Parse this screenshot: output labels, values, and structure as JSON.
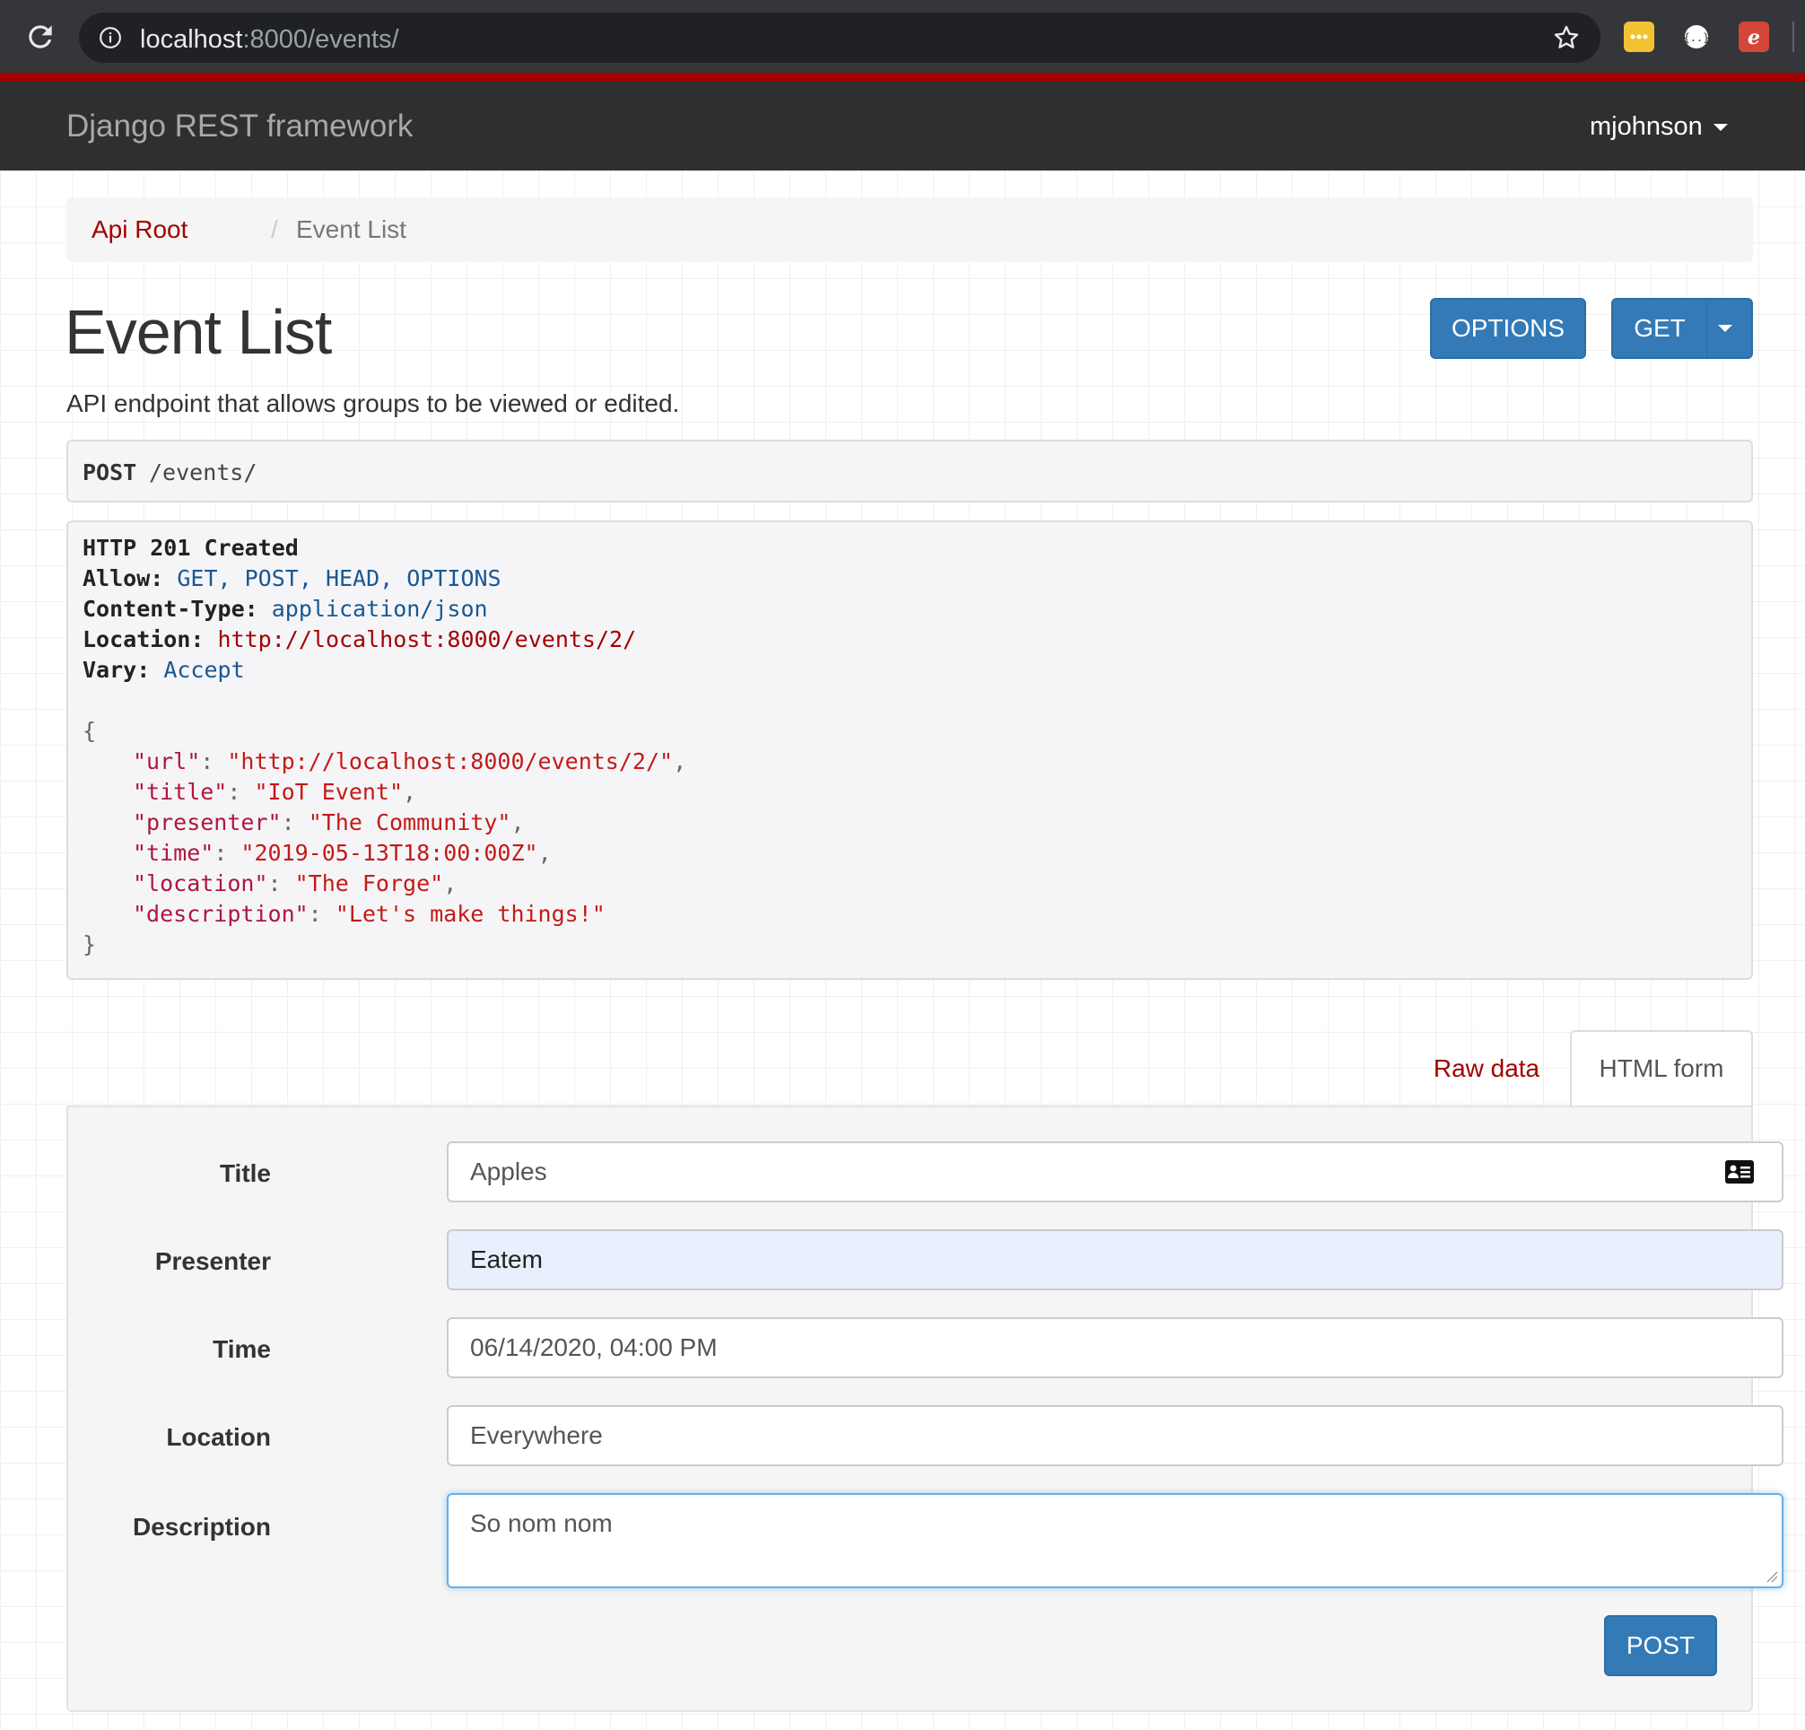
{
  "browser": {
    "url_host": "localhost",
    "url_path": ":8000/events/"
  },
  "navbar": {
    "brand": "Django REST framework",
    "user": "mjohnson"
  },
  "breadcrumb": {
    "root": "Api Root",
    "separator": "/",
    "current": "Event List"
  },
  "page": {
    "title": "Event List",
    "description": "API endpoint that allows groups to be viewed or edited.",
    "options_label": "OPTIONS",
    "get_label": "GET"
  },
  "request": {
    "method": "POST",
    "path": "/events/"
  },
  "response": {
    "status": "HTTP 201 Created",
    "allow_key": "Allow:",
    "allow_val": "GET, POST, HEAD, OPTIONS",
    "ctype_key": "Content-Type:",
    "ctype_val": "application/json",
    "location_key": "Location:",
    "location_val": "http://localhost:8000/events/2/",
    "vary_key": "Vary:",
    "vary_val": "Accept",
    "open_brace": "{",
    "close_brace": "}",
    "body": [
      {
        "key": "\"url\"",
        "value": "\"http://localhost:8000/events/2/\"",
        "trail": ","
      },
      {
        "key": "\"title\"",
        "value": "\"IoT Event\"",
        "trail": ","
      },
      {
        "key": "\"presenter\"",
        "value": "\"The Community\"",
        "trail": ","
      },
      {
        "key": "\"time\"",
        "value": "\"2019-05-13T18:00:00Z\"",
        "trail": ","
      },
      {
        "key": "\"location\"",
        "value": "\"The Forge\"",
        "trail": ","
      },
      {
        "key": "\"description\"",
        "value": "\"Let's make things!\"",
        "trail": ""
      }
    ]
  },
  "tabs": {
    "raw": "Raw data",
    "html": "HTML form"
  },
  "form": {
    "title_label": "Title",
    "title_value": "Apples",
    "presenter_label": "Presenter",
    "presenter_value": "Eatem",
    "time_label": "Time",
    "time_value": "06/14/2020, 04:00 PM",
    "location_label": "Location",
    "location_value": "Everywhere",
    "description_label": "Description",
    "description_value": "So nom nom",
    "post_label": "POST"
  },
  "icons": {
    "reload": "reload-icon",
    "info": "info-icon",
    "star": "star-icon",
    "contact": "contact-card-icon"
  },
  "colors": {
    "brand_red": "#a30000",
    "button_blue": "#337ab7",
    "navbar": "#2f2f2f"
  }
}
